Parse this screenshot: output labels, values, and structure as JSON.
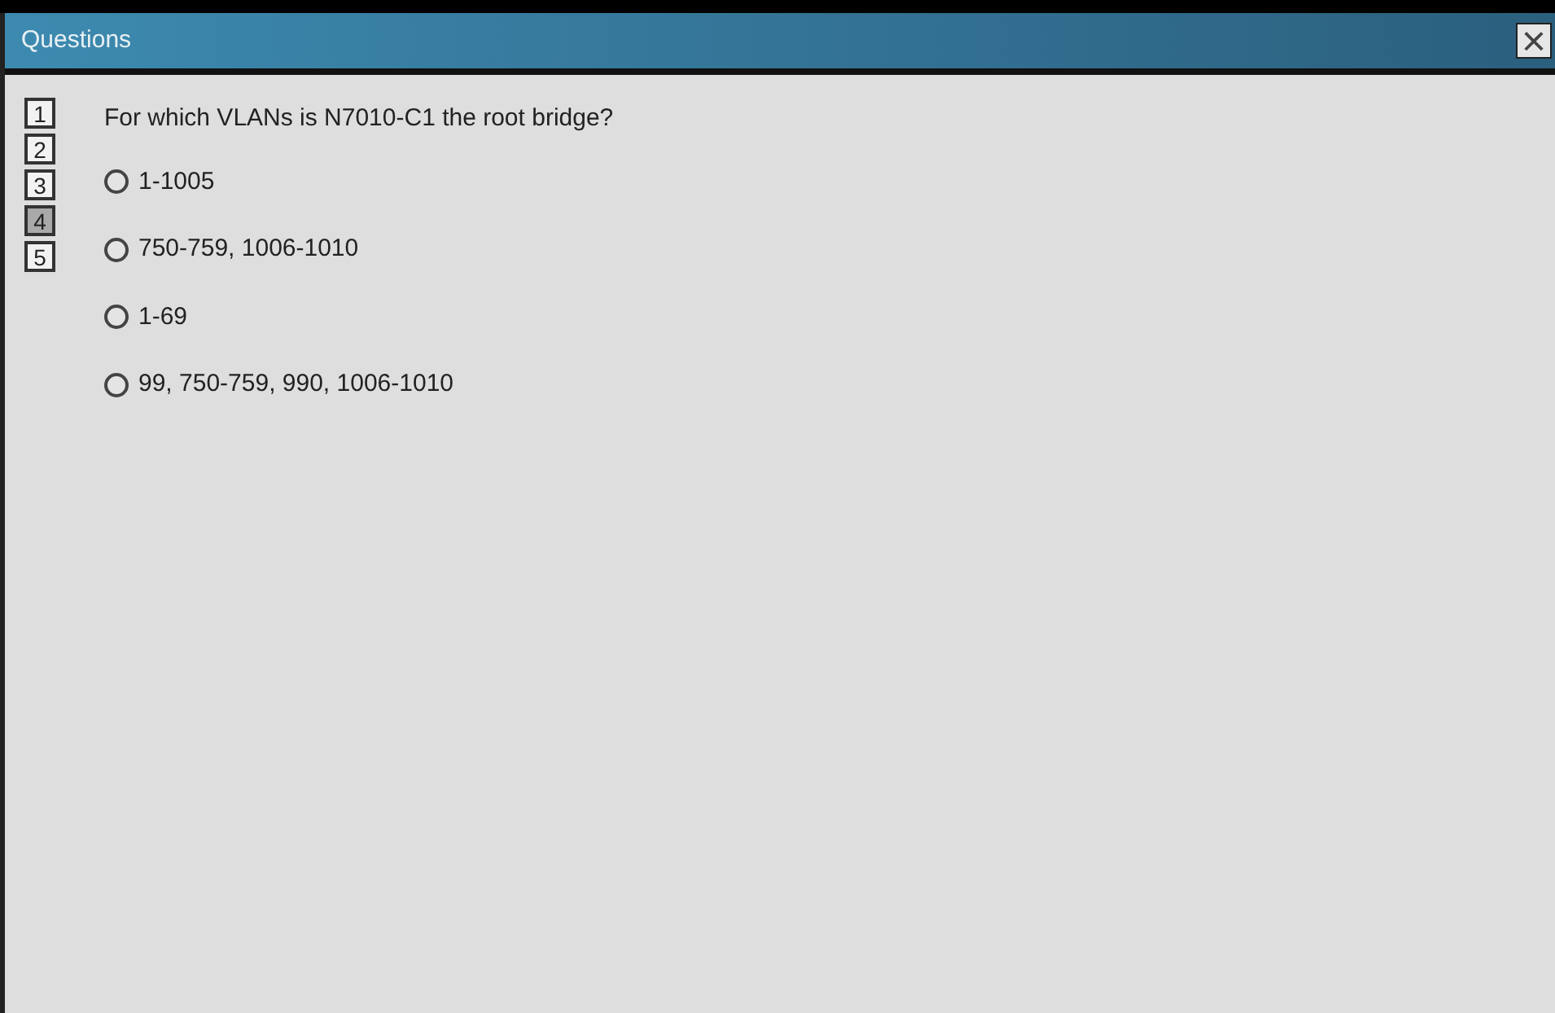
{
  "window": {
    "title": "Questions",
    "close": "×"
  },
  "question_numbers": [
    {
      "label": "1",
      "selected": false
    },
    {
      "label": "2",
      "selected": false
    },
    {
      "label": "3",
      "selected": false
    },
    {
      "label": "4",
      "selected": true
    },
    {
      "label": "5",
      "selected": false
    }
  ],
  "question": "For which VLANs is N7010-C1 the root bridge?",
  "options": [
    {
      "label": "1-1005",
      "selected": false
    },
    {
      "label": "750-759, 1006-1010",
      "selected": false
    },
    {
      "label": "1-69",
      "selected": false
    },
    {
      "label": "99, 750-759, 990, 1006-1010",
      "selected": false
    }
  ]
}
